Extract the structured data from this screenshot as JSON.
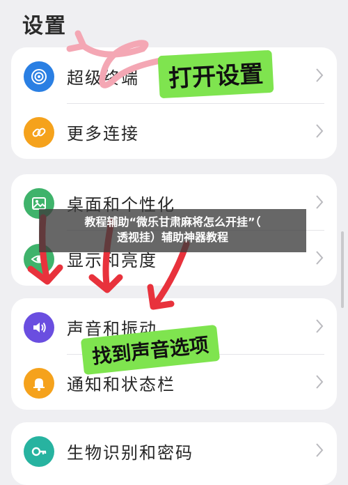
{
  "header": {
    "title": "设置"
  },
  "groups": [
    {
      "items": [
        {
          "label": "超级终端",
          "icon": "super-device-icon",
          "color": "#2a7fe3"
        },
        {
          "label": "更多连接",
          "icon": "link-icon",
          "color": "#f5a21c"
        }
      ]
    },
    {
      "items": [
        {
          "label": "桌面和个性化",
          "icon": "image-icon",
          "color": "#3fb36b"
        },
        {
          "label": "显示和亮度",
          "icon": "eye-icon",
          "color": "#3fb36b"
        }
      ]
    },
    {
      "items": [
        {
          "label": "声音和振动",
          "icon": "sound-icon",
          "color": "#6a4ee0"
        },
        {
          "label": "通知和状态栏",
          "icon": "bell-icon",
          "color": "#f5a21c"
        }
      ]
    },
    {
      "items": [
        {
          "label": "生物识别和密码",
          "icon": "key-icon",
          "color": "#27b3a0"
        }
      ]
    }
  ],
  "annotations": {
    "open_settings": "打开设置",
    "find_sound": "找到声音选项",
    "color": "#7fe44f",
    "arrow_color": "#e8323c"
  },
  "banner": {
    "line1": "教程辅助“微乐甘肃麻将怎么开挂”（",
    "line2": "透视挂）辅助神器教程"
  }
}
